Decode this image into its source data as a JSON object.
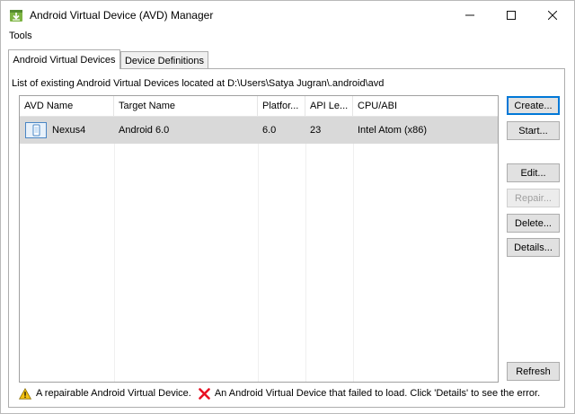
{
  "window": {
    "title": "Android Virtual Device (AVD) Manager"
  },
  "menu": {
    "tools": "Tools"
  },
  "tabs": [
    {
      "label": "Android Virtual Devices",
      "active": true
    },
    {
      "label": "Device Definitions",
      "active": false
    }
  ],
  "avd_list": {
    "description": "List of existing Android Virtual Devices located at D:\\Users\\Satya Jugran\\.android\\avd",
    "columns": [
      "AVD Name",
      "Target Name",
      "Platfor...",
      "API Le...",
      "CPU/ABI"
    ],
    "rows": [
      {
        "avd_name": "Nexus4",
        "target_name": "Android 6.0",
        "platform": "6.0",
        "api_level": "23",
        "cpu_abi": "Intel Atom (x86)"
      }
    ]
  },
  "buttons": {
    "create": "Create...",
    "start": "Start...",
    "edit": "Edit...",
    "repair": "Repair...",
    "delete": "Delete...",
    "details": "Details...",
    "refresh": "Refresh"
  },
  "legend": {
    "repairable": "A repairable Android Virtual Device.",
    "failed": "An Android Virtual Device that failed to load. Click 'Details' to see the error."
  },
  "icons": {
    "app": "android-sdk-download-icon",
    "warning": "warning-triangle-icon",
    "error": "red-x-icon",
    "device": "phone-device-icon"
  },
  "colors": {
    "accent": "#0078d7",
    "selected_row": "#d9d9d9",
    "error": "#e81123",
    "warning": "#f5c211"
  }
}
